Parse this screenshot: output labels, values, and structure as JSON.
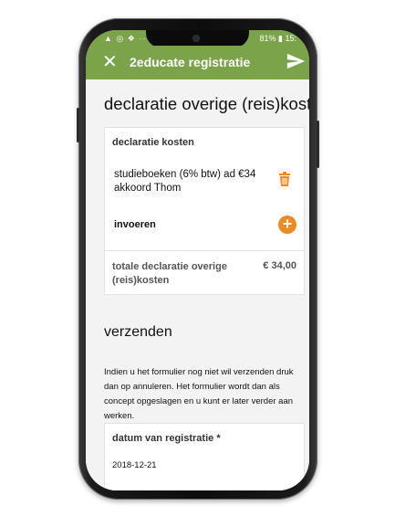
{
  "status": {
    "left": "▲ ◎ ❖ ···",
    "right": "81% ▮ 15:"
  },
  "appbar": {
    "close_icon": "close-icon",
    "title": "2educate registratie",
    "send_icon": "send-icon"
  },
  "page": {
    "heading": "declaratie overige (reis)kosten"
  },
  "declaration_card": {
    "label": "declaratie kosten",
    "item_line1": "studieboeken (6% btw) ad €34",
    "item_line2": "akkoord Thom",
    "trash_icon": "trash-icon",
    "add_label": "invoeren",
    "add_icon": "plus-icon",
    "total_label": "totale declaratie overige (reis)kosten",
    "total_value": "€ 34,00"
  },
  "submit_section": {
    "heading": "verzenden",
    "description": "Indien u het formulier nog niet wil verzenden druk dan op annuleren. Het formulier wordt dan als concept opgeslagen en u kunt er later verder aan werken."
  },
  "date_field": {
    "label": "datum van registratie *",
    "value": "2018-12-21"
  },
  "colors": {
    "accent": "#7aa34a",
    "orange": "#ee8a1f",
    "background": "#f3f3f3"
  }
}
